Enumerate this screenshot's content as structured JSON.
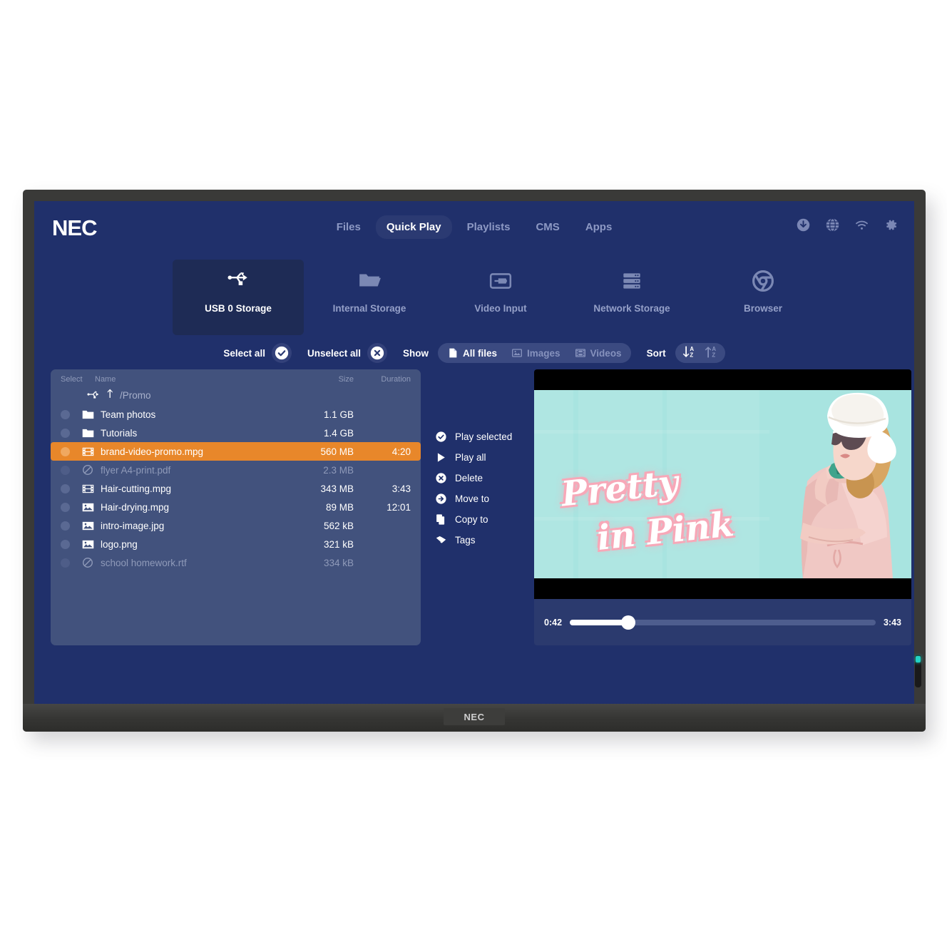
{
  "device": {
    "brand": "NEC",
    "bezel_logo": "NEC"
  },
  "header": {
    "logo": "NEC",
    "tabs": [
      {
        "label": "Files",
        "active": false
      },
      {
        "label": "Quick Play",
        "active": true
      },
      {
        "label": "Playlists",
        "active": false
      },
      {
        "label": "CMS",
        "active": false
      },
      {
        "label": "Apps",
        "active": false
      }
    ],
    "icons": [
      "download-icon",
      "globe-icon",
      "wifi-icon",
      "gear-icon"
    ]
  },
  "sources": [
    {
      "label": "USB 0 Storage",
      "icon": "usb-icon",
      "active": true
    },
    {
      "label": "Internal Storage",
      "icon": "folder-icon",
      "active": false
    },
    {
      "label": "Video Input",
      "icon": "video-input-icon",
      "active": false
    },
    {
      "label": "Network Storage",
      "icon": "server-icon",
      "active": false
    },
    {
      "label": "Browser",
      "icon": "browser-icon",
      "active": false
    }
  ],
  "toolbar": {
    "select_all": "Select all",
    "unselect_all": "Unselect all",
    "show_label": "Show",
    "filters": [
      {
        "label": "All files",
        "icon": "file-icon",
        "active": true
      },
      {
        "label": "Images",
        "icon": "image-icon",
        "active": false
      },
      {
        "label": "Videos",
        "icon": "film-icon",
        "active": false
      }
    ],
    "sort_label": "Sort",
    "sort_desc_icon": "sort-descending-icon",
    "sort_asc_icon": "sort-ascending-icon"
  },
  "file_list": {
    "columns": [
      "Select",
      "Name",
      "Size",
      "Duration"
    ],
    "path": "/Promo",
    "rows": [
      {
        "name": "Team photos",
        "size": "1.1 GB",
        "duration": "",
        "icon": "folder-icon",
        "state": "normal"
      },
      {
        "name": "Tutorials",
        "size": "1.4 GB",
        "duration": "",
        "icon": "folder-icon",
        "state": "normal"
      },
      {
        "name": "brand-video-promo.mpg",
        "size": "560 MB",
        "duration": "4:20",
        "icon": "film-icon",
        "state": "selected"
      },
      {
        "name": "flyer A4-print.pdf",
        "size": "2.3 MB",
        "duration": "",
        "icon": "blocked-icon",
        "state": "disabled"
      },
      {
        "name": "Hair-cutting.mpg",
        "size": "343 MB",
        "duration": "3:43",
        "icon": "film-icon",
        "state": "normal"
      },
      {
        "name": "Hair-drying.mpg",
        "size": "89 MB",
        "duration": "12:01",
        "icon": "image-icon",
        "state": "normal"
      },
      {
        "name": "intro-image.jpg",
        "size": "562 kB",
        "duration": "",
        "icon": "image-icon",
        "state": "normal"
      },
      {
        "name": "logo.png",
        "size": "321 kB",
        "duration": "",
        "icon": "image-icon",
        "state": "normal"
      },
      {
        "name": "school homework.rtf",
        "size": "334 kB",
        "duration": "",
        "icon": "blocked-icon",
        "state": "disabled"
      }
    ]
  },
  "actions": [
    {
      "label": "Play selected",
      "icon": "check-circle-icon"
    },
    {
      "label": "Play all",
      "icon": "play-icon"
    },
    {
      "label": "Delete",
      "icon": "x-circle-icon"
    },
    {
      "label": "Move to",
      "icon": "arrow-right-circle-icon"
    },
    {
      "label": "Copy to",
      "icon": "copy-icon"
    },
    {
      "label": "Tags",
      "icon": "tag-icon"
    }
  ],
  "player": {
    "current_time": "0:42",
    "total_time": "3:43",
    "progress_percent": 19,
    "poster_text_line1": "Pretty",
    "poster_text_line2": "in Pink"
  },
  "colors": {
    "screen_bg": "#20306b",
    "panel_bg": "#42527d",
    "accent_orange": "#e8872a",
    "tile_active": "#1e2b55",
    "muted_text": "#8f9ab9",
    "poster_bg": "#a8e4e0",
    "poster_pink": "#f7a8b8"
  }
}
